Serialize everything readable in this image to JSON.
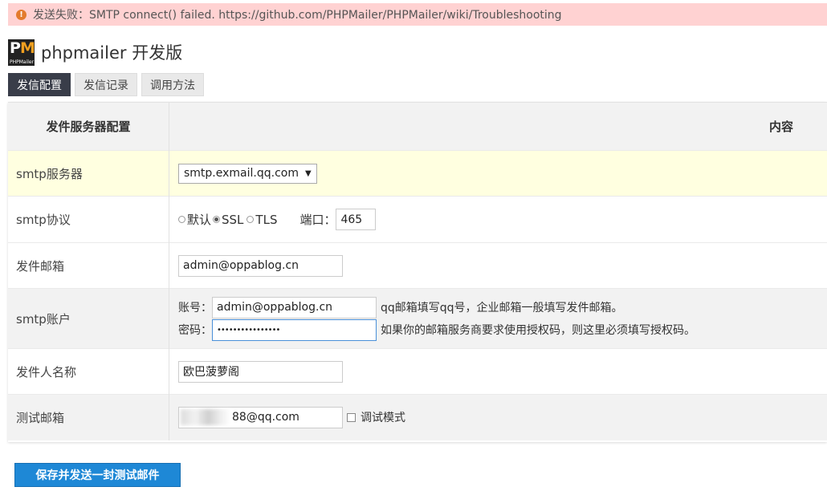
{
  "alert": {
    "icon": "warning-circle-icon",
    "text": "发送失败：SMTP connect() failed. https://github.com/PHPMailer/PHPMailer/wiki/Troubleshooting"
  },
  "header": {
    "logo_text": "PM",
    "logo_sub": "PHPMailer",
    "title": "phpmailer 开发版"
  },
  "tabs": [
    {
      "label": "发信配置",
      "active": true
    },
    {
      "label": "发信记录",
      "active": false
    },
    {
      "label": "调用方法",
      "active": false
    }
  ],
  "table": {
    "headers": [
      "发件服务器配置",
      "内容"
    ],
    "rows": {
      "server": {
        "label": "smtp服务器",
        "value": "smtp.exmail.qq.com"
      },
      "protocol": {
        "label": "smtp协议",
        "options": [
          "默认",
          "SSL",
          "TLS"
        ],
        "selected": "SSL",
        "port_label": "端口：",
        "port_value": "465"
      },
      "from_email": {
        "label": "发件邮箱",
        "value": "admin@oppablog.cn"
      },
      "account": {
        "label": "smtp账户",
        "user_label": "账号：",
        "user_value": "admin@oppablog.cn",
        "user_hint": "qq邮箱填写qq号，企业邮箱一般填写发件邮箱。",
        "pass_label": "密码：",
        "pass_value": "••••••••••••••••",
        "pass_hint": "如果你的邮箱服务商要求使用授权码，则这里必须填写授权码。"
      },
      "sender_name": {
        "label": "发件人名称",
        "value": "欧巴菠萝阁"
      },
      "test_email": {
        "label": "测试邮箱",
        "value": "88@qq.com",
        "debug_label": "调试模式",
        "debug_checked": false
      }
    }
  },
  "submit_label": "保存并发送一封测试邮件"
}
